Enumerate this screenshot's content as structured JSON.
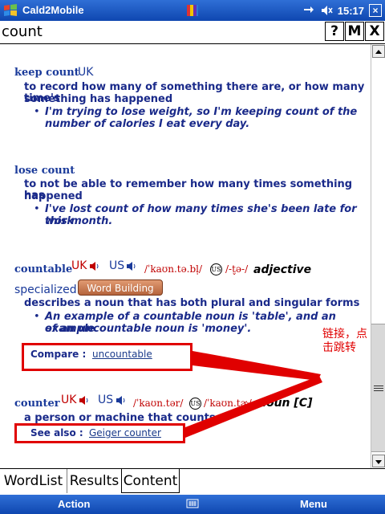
{
  "titlebar": {
    "app_title": "Cald2Mobile",
    "time": "15:17",
    "ok_label": "×"
  },
  "search": {
    "value": "count",
    "help_label": "?",
    "m_label": "M",
    "close_label": "X"
  },
  "entries": {
    "keep_count": {
      "headword": "keep count",
      "region": "UK",
      "definition_1": "to record how many of something there are, or how many time's",
      "definition_2": "something has happened",
      "example_1": "I'm trying to lose weight, so I'm keeping count of the",
      "example_2": "number of calories I eat every day."
    },
    "lose_count": {
      "headword": "lose count",
      "definition_1": "to not be able to remember how many times something has",
      "definition_2": "happened",
      "example_1": "I've lost count of how many times she's been late for work",
      "example_2": "this month."
    },
    "countable": {
      "headword": "countable",
      "uk": "UK",
      "us": "US",
      "ipa_uk": "/ˈkaʊn.tə.bl̩/",
      "us_circle": "US",
      "ipa_us": "/-t̬ə-/",
      "pos": "adjective",
      "register": "specialized",
      "word_building": "Word Building",
      "definition": "describes a noun that has both plural and singular forms",
      "example_1": "An example of a countable noun is 'table', and an example",
      "example_2": "of an uncountable noun is 'money'.",
      "compare_label": "Compare :",
      "compare_link": "uncountable"
    },
    "counter": {
      "headword": "counter",
      "uk": "UK",
      "us": "US",
      "ipa_uk": "/ˈkaʊn.tər/",
      "us_circle": "US",
      "ipa_us": "/ˈkaʊn.t̬ɚ/",
      "pos": "noun [C]",
      "definition": "a person or machine that counts",
      "see_also_label": "See also :",
      "see_also_link": "Geiger counter"
    }
  },
  "annotation": "链接，点击跳转",
  "tabs": [
    "WordList",
    "Results",
    "Content"
  ],
  "active_tab": "Content",
  "menubar": {
    "left": "Action",
    "right": "Menu"
  },
  "colors": {
    "titlebar": "#1452c4",
    "headword": "#1a3a9a",
    "pron": "#c00000",
    "annotation": "#e00000"
  }
}
